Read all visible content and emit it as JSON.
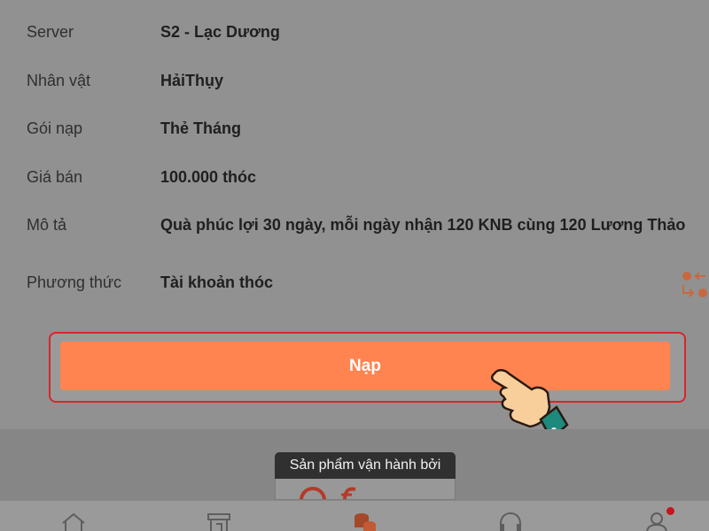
{
  "details": [
    {
      "label": "Server",
      "value": "S2 - Lạc Dương"
    },
    {
      "label": "Nhân vật",
      "value": "HảiThụy"
    },
    {
      "label": "Gói nạp",
      "value": "Thẻ Tháng"
    },
    {
      "label": "Giá bán",
      "value": "100.000 thóc"
    },
    {
      "label": "Mô tả",
      "value": "Quà phúc lợi 30 ngày, mỗi ngày nhận 120 KNB cùng 120 Lương Thảo"
    },
    {
      "label": "Phương thức",
      "value": "Tài khoản thóc"
    }
  ],
  "action": {
    "submit_label": "Nạp"
  },
  "footer": {
    "powered_by": "Sản phẩm vận hành bởi"
  },
  "nav": {
    "icons": [
      "home-icon",
      "store-icon",
      "coins-icon",
      "headset-icon",
      "user-icon"
    ],
    "notification_badge": true
  },
  "colors": {
    "accent": "#ff8450",
    "highlight_border": "#d6262b",
    "overlay": "#919191"
  },
  "icons": {
    "swap": "swap-method-icon",
    "pointer": "pointing-hand-icon"
  }
}
